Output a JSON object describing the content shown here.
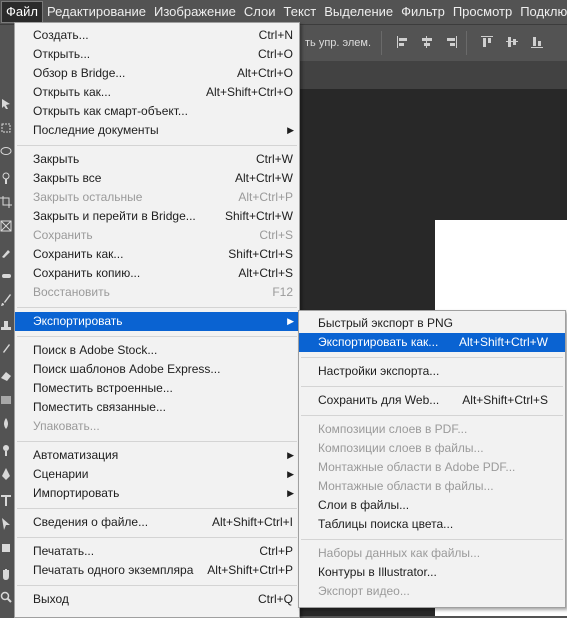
{
  "menubar": {
    "app_icon": "photoshop-icon",
    "items": [
      "Файл",
      "Редактирование",
      "Изображение",
      "Слои",
      "Текст",
      "Выделение",
      "Фильтр",
      "Просмотр",
      "Подклю"
    ],
    "active_index": 0
  },
  "options_bar": {
    "text": "ть упр. элем."
  },
  "file_menu": {
    "items": [
      {
        "label": "Создать...",
        "shortcut": "Ctrl+N",
        "disabled": false,
        "submenu": false
      },
      {
        "label": "Открыть...",
        "shortcut": "Ctrl+O",
        "disabled": false,
        "submenu": false
      },
      {
        "label": "Обзор в Bridge...",
        "shortcut": "Alt+Ctrl+O",
        "disabled": false,
        "submenu": false
      },
      {
        "label": "Открыть как...",
        "shortcut": "Alt+Shift+Ctrl+O",
        "disabled": false,
        "submenu": false
      },
      {
        "label": "Открыть как смарт-объект...",
        "shortcut": "",
        "disabled": false,
        "submenu": false
      },
      {
        "label": "Последние документы",
        "shortcut": "",
        "disabled": false,
        "submenu": true
      },
      {
        "label": "Закрыть",
        "shortcut": "Ctrl+W",
        "disabled": false,
        "submenu": false
      },
      {
        "label": "Закрыть все",
        "shortcut": "Alt+Ctrl+W",
        "disabled": false,
        "submenu": false
      },
      {
        "label": "Закрыть остальные",
        "shortcut": "Alt+Ctrl+P",
        "disabled": true,
        "submenu": false
      },
      {
        "label": "Закрыть и перейти в Bridge...",
        "shortcut": "Shift+Ctrl+W",
        "disabled": false,
        "submenu": false
      },
      {
        "label": "Сохранить",
        "shortcut": "Ctrl+S",
        "disabled": true,
        "submenu": false
      },
      {
        "label": "Сохранить как...",
        "shortcut": "Shift+Ctrl+S",
        "disabled": false,
        "submenu": false
      },
      {
        "label": "Сохранить копию...",
        "shortcut": "Alt+Ctrl+S",
        "disabled": false,
        "submenu": false
      },
      {
        "label": "Восстановить",
        "shortcut": "F12",
        "disabled": true,
        "submenu": false
      },
      {
        "label": "Экспортировать",
        "shortcut": "",
        "disabled": false,
        "submenu": true,
        "highlighted": true
      },
      {
        "label": "Поиск в Adobe Stock...",
        "shortcut": "",
        "disabled": false,
        "submenu": false
      },
      {
        "label": "Поиск шаблонов Adobe Express...",
        "shortcut": "",
        "disabled": false,
        "submenu": false
      },
      {
        "label": "Поместить встроенные...",
        "shortcut": "",
        "disabled": false,
        "submenu": false
      },
      {
        "label": "Поместить связанные...",
        "shortcut": "",
        "disabled": false,
        "submenu": false
      },
      {
        "label": "Упаковать...",
        "shortcut": "",
        "disabled": true,
        "submenu": false
      },
      {
        "label": "Автоматизация",
        "shortcut": "",
        "disabled": false,
        "submenu": true
      },
      {
        "label": "Сценарии",
        "shortcut": "",
        "disabled": false,
        "submenu": true
      },
      {
        "label": "Импортировать",
        "shortcut": "",
        "disabled": false,
        "submenu": true
      },
      {
        "label": "Сведения о файле...",
        "shortcut": "Alt+Shift+Ctrl+I",
        "disabled": false,
        "submenu": false
      },
      {
        "label": "Печатать...",
        "shortcut": "Ctrl+P",
        "disabled": false,
        "submenu": false
      },
      {
        "label": "Печатать одного экземпляра",
        "shortcut": "Alt+Shift+Ctrl+P",
        "disabled": false,
        "submenu": false
      },
      {
        "label": "Выход",
        "shortcut": "Ctrl+Q",
        "disabled": false,
        "submenu": false
      }
    ]
  },
  "export_menu": {
    "items": [
      {
        "label": "Быстрый экспорт в PNG",
        "shortcut": "",
        "disabled": false
      },
      {
        "label": "Экспортировать как...",
        "shortcut": "Alt+Shift+Ctrl+W",
        "disabled": false,
        "highlighted": true
      },
      {
        "label": "Настройки экспорта...",
        "shortcut": "",
        "disabled": false
      },
      {
        "label": "Сохранить для Web...",
        "shortcut": "Alt+Shift+Ctrl+S",
        "disabled": false
      },
      {
        "label": "Композиции слоев в PDF...",
        "shortcut": "",
        "disabled": true
      },
      {
        "label": "Композиции слоев в файлы...",
        "shortcut": "",
        "disabled": true
      },
      {
        "label": "Монтажные области в Adobe PDF...",
        "shortcut": "",
        "disabled": true
      },
      {
        "label": "Монтажные области в файлы...",
        "shortcut": "",
        "disabled": true
      },
      {
        "label": "Слои в файлы...",
        "shortcut": "",
        "disabled": false
      },
      {
        "label": "Таблицы поиска цвета...",
        "shortcut": "",
        "disabled": false
      },
      {
        "label": "Наборы данных как файлы...",
        "shortcut": "",
        "disabled": true
      },
      {
        "label": "Контуры в Illustrator...",
        "shortcut": "",
        "disabled": false
      },
      {
        "label": "Экспорт видео...",
        "shortcut": "",
        "disabled": true
      }
    ]
  },
  "colors": {
    "highlight": "#0a63d2",
    "menu_bg": "#f2f2f2",
    "chrome": "#535353",
    "workspace": "#282828",
    "disabled_text": "#9a9a9a"
  }
}
